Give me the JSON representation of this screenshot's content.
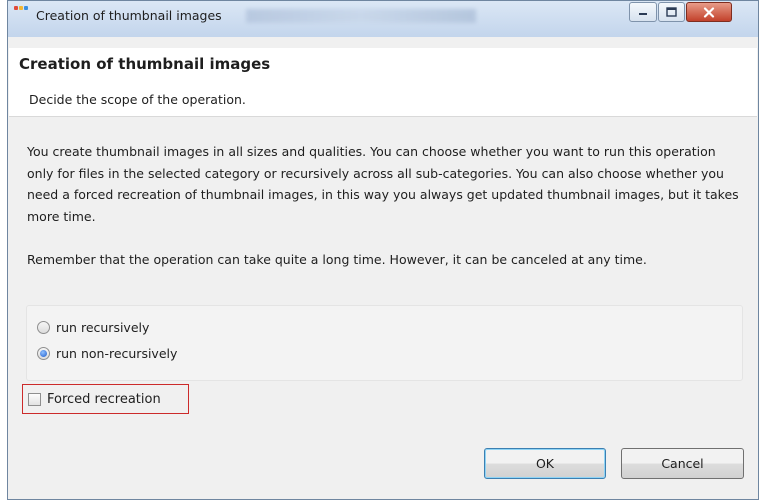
{
  "window": {
    "title": "Creation of thumbnail images",
    "buttons": {
      "minimize_icon": "minimize-icon",
      "maximize_icon": "maximize-icon",
      "close_icon": "close-icon"
    }
  },
  "header": {
    "title": "Creation of thumbnail images",
    "subtitle": "Decide the scope of the operation."
  },
  "description": {
    "paragraph1": "You create thumbnail images in all sizes and qualities. You can choose whether you want to run this operation only for files in the selected category or recursively across all sub-categories. You can also choose whether you need a forced recreation of thumbnail images, in this way you always get updated thumbnail images, but it takes more time.",
    "paragraph2": "Remember that the operation can take quite a long time. However, it can be canceled at any time."
  },
  "options": {
    "radios": [
      {
        "label": "run recursively",
        "checked": false
      },
      {
        "label": "run non-recursively",
        "checked": true
      }
    ],
    "forced_recreation": {
      "label": "Forced recreation",
      "checked": false
    }
  },
  "buttons": {
    "ok": "OK",
    "cancel": "Cancel"
  },
  "colors": {
    "highlight_border": "#cc2a2a",
    "default_button_border": "#3c7fb1",
    "close_button": "#c2412b"
  }
}
